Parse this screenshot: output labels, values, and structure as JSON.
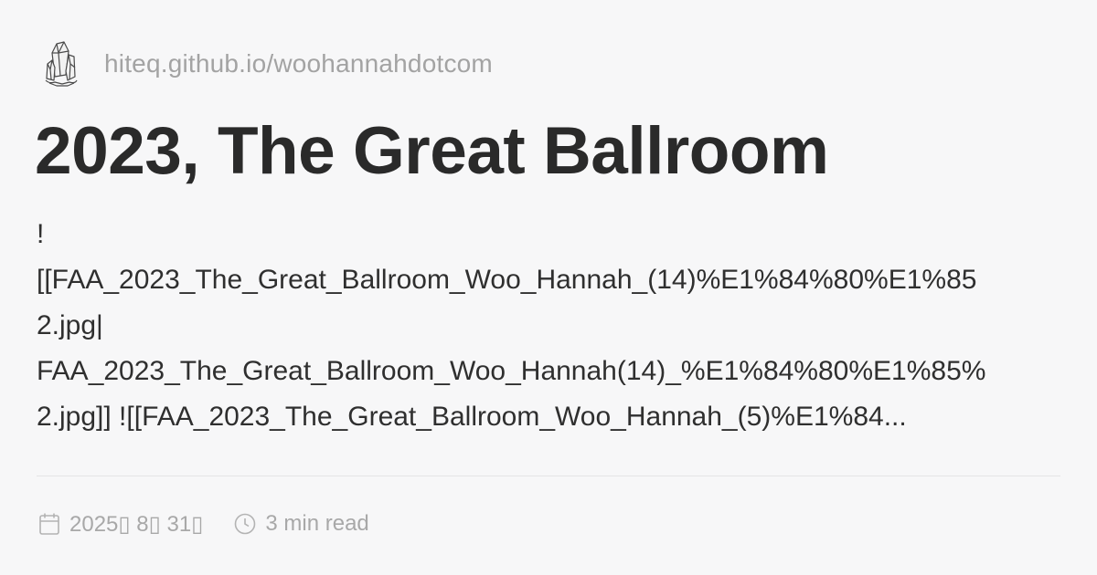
{
  "site": {
    "logo_icon": "crystal-icon",
    "url": "hiteq.github.io/woohannahdotcom"
  },
  "post": {
    "title": "2023, The Great Ballroom",
    "excerpt_lines": [
      "!",
      "[[FAA_2023_The_Great_Ballroom_Woo_Hannah_(14)%E1%84%80%E1%85",
      "2.jpg|",
      "FAA_2023_The_Great_Ballroom_Woo_Hannah(14)_%E1%84%80%E1%85%",
      "2.jpg]] ![[FAA_2023_The_Great_Ballroom_Woo_Hannah_(5)%E1%84..."
    ]
  },
  "meta": {
    "date_icon": "calendar-icon",
    "date": "2025▯ 8▯ 31▯",
    "read_icon": "clock-icon",
    "read_time": "3 min read"
  },
  "colors": {
    "background": "#f7f7f8",
    "title": "#2a2a2a",
    "muted": "#a8a8a8",
    "divider": "#e4e4e6"
  }
}
